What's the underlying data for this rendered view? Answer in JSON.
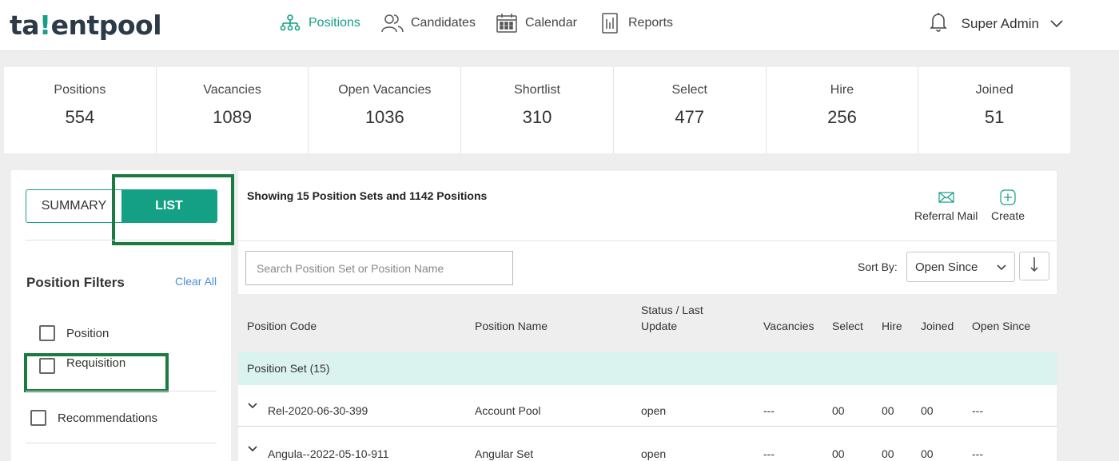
{
  "header": {
    "logo_pre": "ta",
    "logo_dot": "!",
    "logo_post": "entpool",
    "nav": [
      {
        "label": "Positions",
        "icon": "org-chart-icon",
        "active": true
      },
      {
        "label": "Candidates",
        "icon": "users-icon",
        "active": false
      },
      {
        "label": "Calendar",
        "icon": "calendar-icon",
        "active": false
      },
      {
        "label": "Reports",
        "icon": "report-icon",
        "active": false
      }
    ],
    "user_name": "Super Admin"
  },
  "stats": [
    {
      "label": "Positions",
      "value": "554"
    },
    {
      "label": "Vacancies",
      "value": "1089"
    },
    {
      "label": "Open Vacancies",
      "value": "1036"
    },
    {
      "label": "Shortlist",
      "value": "310"
    },
    {
      "label": "Select",
      "value": "477"
    },
    {
      "label": "Hire",
      "value": "256"
    },
    {
      "label": "Joined",
      "value": "51"
    }
  ],
  "sidebar": {
    "view_summary": "SUMMARY",
    "view_list": "LIST",
    "filters_title": "Position Filters",
    "clear_all": "Clear All",
    "filters": [
      {
        "label": "Position",
        "checked": false
      },
      {
        "label": "Requisition",
        "checked": false
      },
      {
        "label": "Recommendations",
        "checked": false
      }
    ]
  },
  "main": {
    "showing": "Showing 15 Position Sets and 1142 Positions",
    "referral_mail": "Referral Mail",
    "create": "Create",
    "search_placeholder": "Search Position Set or Position Name",
    "sort_by_label": "Sort By:",
    "sort_by_value": "Open Since",
    "columns": {
      "code": "Position Code",
      "name": "Position Name",
      "status_line1": "Status / Last",
      "status_line2": "Update",
      "vacancies": "Vacancies",
      "select": "Select",
      "hire": "Hire",
      "joined": "Joined",
      "open_since": "Open Since"
    },
    "group_label": "Position Set (15)",
    "rows": [
      {
        "code": "Rel-2020-06-30-399",
        "name": "Account Pool",
        "status": "open",
        "vacancies": "---",
        "select": "00",
        "hire": "00",
        "joined": "00",
        "open_since": "---"
      },
      {
        "code": "Angula--2022-05-10-911",
        "name": "Angular Set",
        "status": "open",
        "vacancies": "---",
        "select": "00",
        "hire": "00",
        "joined": "00",
        "open_since": "---"
      }
    ]
  },
  "colors": {
    "accent": "#14a085",
    "highlight_box": "#1a7a40",
    "link": "#4a90d9"
  }
}
